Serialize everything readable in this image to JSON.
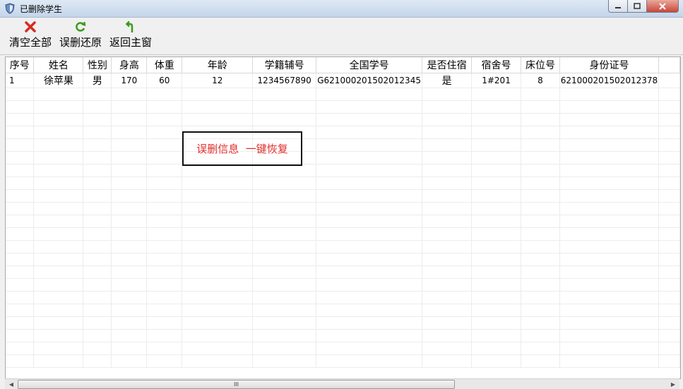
{
  "window": {
    "title": "已删除学生",
    "icon": "shield-app-icon"
  },
  "toolbar": {
    "clear_all": {
      "label": "清空全部",
      "icon": "red-x-icon"
    },
    "restore": {
      "label": "误删还原",
      "icon": "green-refresh-icon"
    },
    "return_main": {
      "label": "返回主窗",
      "icon": "green-return-arrow-icon"
    }
  },
  "table": {
    "columns": [
      "序号",
      "姓名",
      "性别",
      "身高",
      "体重",
      "年龄",
      "学籍辅号",
      "全国学号",
      "是否住宿",
      "宿舍号",
      "床位号",
      "身份证号"
    ],
    "rows": [
      [
        "1",
        "徐苹果",
        "男",
        "170",
        "60",
        "12",
        "1234567890",
        "G621000201502012345",
        "是",
        "1#201",
        "8",
        "621000201502012378"
      ]
    ]
  },
  "annotation": {
    "text": "误删信息  一键恢复",
    "color": "#e0302c"
  },
  "scrollbar": {
    "thumb_grip": "III"
  }
}
